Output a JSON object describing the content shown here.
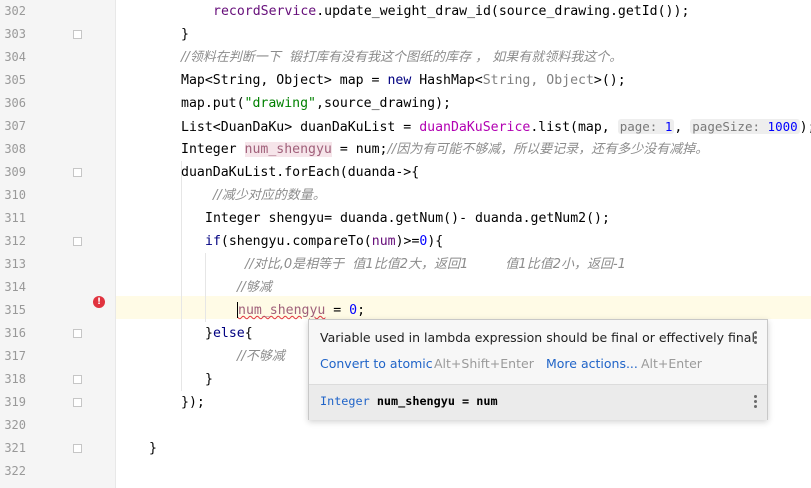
{
  "editor": {
    "line_numbers": [
      "302",
      "303",
      "304",
      "305",
      "306",
      "307",
      "308",
      "309",
      "310",
      "311",
      "312",
      "313",
      "314",
      "315",
      "316",
      "317",
      "318",
      "319",
      "320",
      "321",
      "322"
    ],
    "code": {
      "l302": {
        "obj": "recordService",
        "rest": ".update_weight_draw_id(source_drawing.getId());"
      },
      "l303": "}",
      "l304": "//领料在判断一下  锻打库有没有我这个图纸的库存 ， 如果有就领料我这个。",
      "l305": {
        "a": "Map<String, Object> map = ",
        "kw": "new",
        "b": " HashMap<",
        "g": "String, Object",
        "c": ">();"
      },
      "l306": {
        "a": "map.put(",
        "str": "\"drawing\"",
        "b": ",source_drawing);"
      },
      "l307": {
        "a": "List<DuanDaKu> duanDaKuList = ",
        "svc": "duanDaKuSerice",
        "b": ".list(map, ",
        "h1": "page:",
        "v1": "1",
        "c": ", ",
        "h2": "pageSize:",
        "v2": "1000",
        "d": ");"
      },
      "l308": {
        "a": "Integer ",
        "var": "num_shengyu",
        "b": " = num;",
        "cm": "//因为有可能不够减，所以要记录，还有多少没有减掉。"
      },
      "l309": {
        "a": "duanDaKuList.forEach(duanda->{"
      },
      "l310": "//减少对应的数量。",
      "l311": {
        "a": "Integer shengyu= duanda.getNum()- duanda.getNum2();"
      },
      "l312": {
        "kw": "if",
        "a": "(shengyu.compareTo(",
        "p": "num",
        "b": ")>=",
        "n": "0",
        "c": "){"
      },
      "l313": "//对比,0是相等于  值1比值2大，返回1         值1比值2小，返回-1",
      "l314": "//够减",
      "l315": {
        "var": "num_shengyu",
        "a": " = ",
        "n": "0",
        "b": ";"
      },
      "l316": {
        "a": "}",
        "kw": "else",
        "b": "{"
      },
      "l317": "//不够减",
      "l318": "}",
      "l319": "});",
      "l321": "}"
    }
  },
  "popup": {
    "message": "Variable used in lambda expression should be final or effectively final",
    "action1": "Convert to atomic",
    "action1_shortcut": "Alt+Shift+Enter",
    "action2": "More actions...",
    "action2_shortcut": "Alt+Enter",
    "footer_type": "Integer",
    "footer_decl": "num_shengyu = num",
    "more_icon": "vertical-ellipsis-icon"
  },
  "colors": {
    "error": "#e0333f",
    "keyword": "#000080",
    "field": "#660e7a",
    "string": "#008000",
    "number": "#0000ff",
    "comment": "#8c8c8c",
    "link": "#2064c8"
  }
}
